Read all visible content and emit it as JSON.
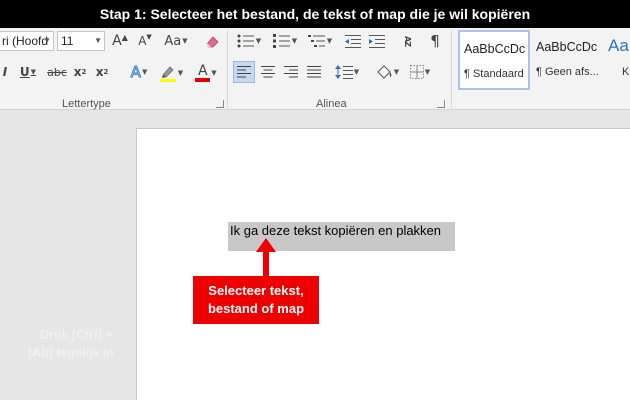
{
  "banner": {
    "text": "Stap 1: Selecteer het bestand, de tekst of map die je wil kopiëren"
  },
  "ribbon": {
    "font": {
      "name_value": "ri (Hoofd",
      "size_value": "11",
      "grow_label": "A",
      "shrink_label": "A",
      "case_label": "Aa",
      "italic_label": "I",
      "underline_label": "U",
      "strike_label": "abc",
      "subscript_label": "x",
      "subscript_mark": "2",
      "superscript_label": "x",
      "superscript_mark": "2",
      "effects_label": "A",
      "font_color_label": "A",
      "group_label": "Lettertype",
      "icons": {
        "clear_format": "eraser-icon",
        "highlight": "highlighter-icon"
      }
    },
    "paragraph": {
      "sort_label": "AZ",
      "pilcrow_label": "¶",
      "group_label": "Alinea",
      "icons": {
        "bullets": "bullet-list-icon",
        "numbering": "numbered-list-icon",
        "multilevel": "multilevel-list-icon",
        "decrease_indent": "decrease-indent-icon",
        "increase_indent": "increase-indent-icon",
        "align_left": "align-left-icon",
        "align_center": "align-center-icon",
        "align_right": "align-right-icon",
        "justify": "justify-icon",
        "line_spacing": "line-spacing-icon",
        "shading": "shading-icon",
        "borders": "borders-icon"
      }
    },
    "styles": [
      {
        "sample": "AaBbCcDc",
        "name": "¶ Standaard",
        "active": true
      },
      {
        "sample": "AaBbCcDc",
        "name": "¶ Geen afs...",
        "active": false
      },
      {
        "sample": "Aa",
        "name": "K",
        "active": false
      }
    ]
  },
  "document": {
    "text": "Ik ga deze tekst kopiëren en plakken"
  },
  "callout": {
    "line1": "Selecteer tekst,",
    "line2": "bestand of map"
  },
  "faint_overlay": {
    "line1": "Druk [Ctrl] +",
    "line2": "[Alt] tegelijk in"
  },
  "colors": {
    "banner_bg": "#000000",
    "callout_bg": "#ee0000",
    "selection": "#c8c8c8",
    "highlight_bar": "#ffff00",
    "font_color_bar": "#e00000",
    "active_align_bg": "#c5d8ef"
  }
}
